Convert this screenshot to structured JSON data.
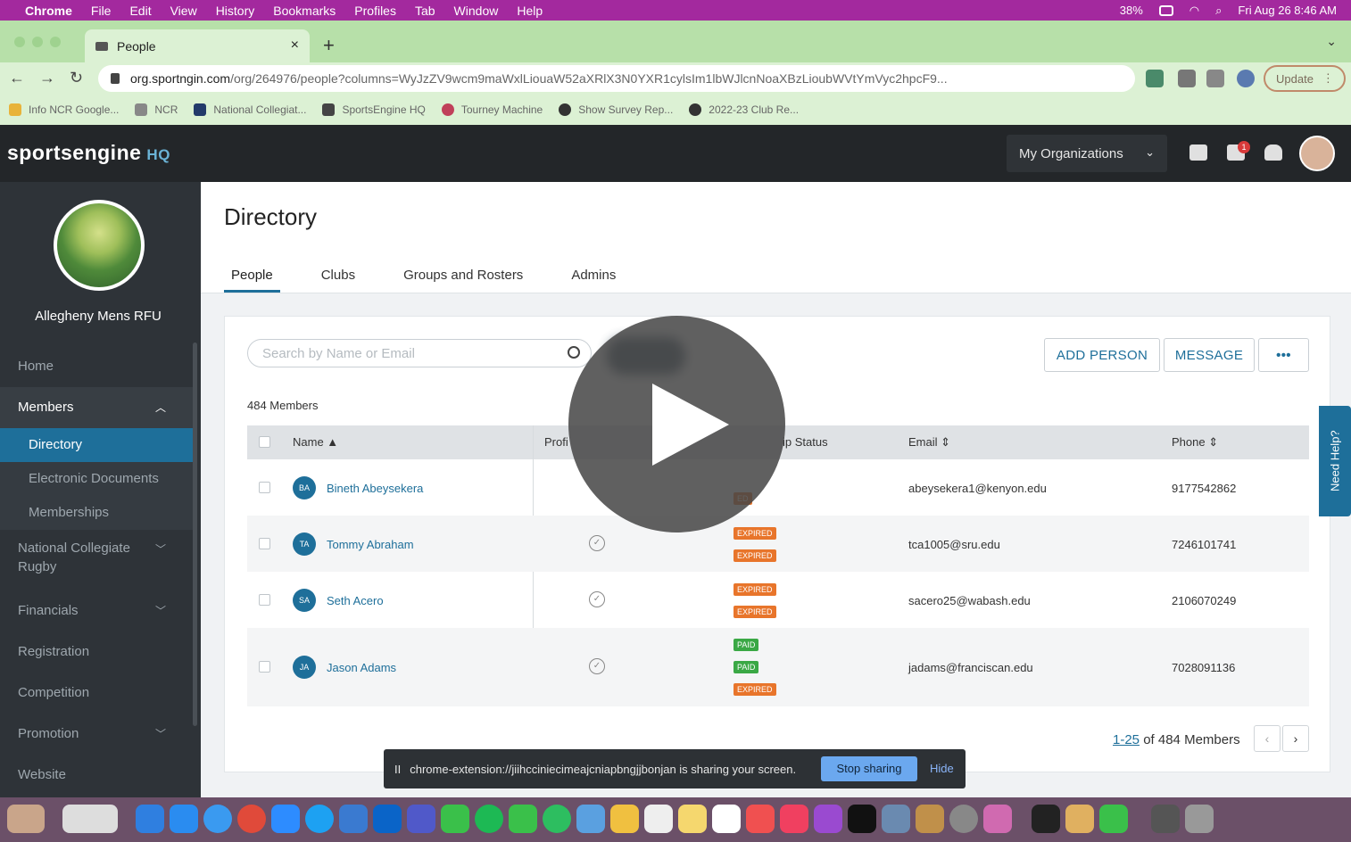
{
  "mac_menu": {
    "app": "Chrome",
    "items": [
      "File",
      "Edit",
      "View",
      "History",
      "Bookmarks",
      "Profiles",
      "Tab",
      "Window",
      "Help"
    ],
    "battery": "38%",
    "datetime": "Fri Aug 26  8:46 AM"
  },
  "browser": {
    "tab_title": "People",
    "url_host": "org.sportngin.com",
    "url_path": "/org/264976/people?columns=WyJzZV9wcm9maWxlLiouaW52aXRlX3N0YXR1cylsIm1lbWJlcnNoaXBzLioubWVtYmVyc2hpcF9...",
    "update_label": "Update",
    "bookmarks": [
      "Info NCR Google...",
      "NCR",
      "National Collegiat...",
      "SportsEngine HQ",
      "Tourney Machine",
      "Show Survey Rep...",
      "2022-23 Club Re..."
    ]
  },
  "header": {
    "logo": "sportsengine",
    "logo_suffix": "HQ",
    "my_orgs": "My Organizations",
    "notification_count": "1"
  },
  "sidebar": {
    "org_name": "Allegheny Mens RFU",
    "items": [
      {
        "label": "Home"
      },
      {
        "label": "Members"
      },
      {
        "label": "Directory"
      },
      {
        "label": "Electronic Documents"
      },
      {
        "label": "Memberships"
      },
      {
        "label": "National Collegiate Rugby"
      },
      {
        "label": "Financials"
      },
      {
        "label": "Registration"
      },
      {
        "label": "Competition"
      },
      {
        "label": "Promotion"
      },
      {
        "label": "Website"
      }
    ]
  },
  "main": {
    "title": "Directory",
    "tabs": [
      "People",
      "Clubs",
      "Groups and Rosters",
      "Admins"
    ],
    "search_placeholder": "Search by Name or Email",
    "add_person": "ADD PERSON",
    "message": "MESSAGE",
    "more": "•••",
    "member_count": "484 Members",
    "columns": {
      "name": "Name ▲",
      "profile": "Profi",
      "status": "ip Status",
      "email": "Email ⇕",
      "phone": "Phone ⇕"
    },
    "rows": [
      {
        "initials": "BA",
        "name": "Bineth Abeysekera",
        "email": "abeysekera1@kenyon.edu",
        "phone": "9177542862",
        "tags": [
          "ED"
        ]
      },
      {
        "initials": "TA",
        "name": "Tommy Abraham",
        "email": "tca1005@sru.edu",
        "phone": "7246101741",
        "tags": [
          "EXPIRED",
          "EXPIRED"
        ]
      },
      {
        "initials": "SA",
        "name": "Seth Acero",
        "email": "sacero25@wabash.edu",
        "phone": "2106070249",
        "tags": [
          "EXPIRED",
          "EXPIRED"
        ]
      },
      {
        "initials": "JA",
        "name": "Jason Adams",
        "email": "jadams@franciscan.edu",
        "phone": "7028091136",
        "tags": [
          "PAID",
          "PAID",
          "EXPIRED"
        ]
      }
    ],
    "pager_range": "1-25",
    "pager_rest": " of 484 Members"
  },
  "need_help": "Need Help?",
  "share_bar": {
    "pause_icon": "II",
    "text": "chrome-extension://jiihcciniecimeajcniapbngjjbonjan is sharing your screen.",
    "stop": "Stop sharing",
    "hide": "Hide"
  },
  "colors": {
    "accent": "#1e6f9a",
    "expired": "#e8752b",
    "paid": "#3aa845",
    "menubar": "#a3299e",
    "browser_chrome": "#dcf1d4"
  }
}
